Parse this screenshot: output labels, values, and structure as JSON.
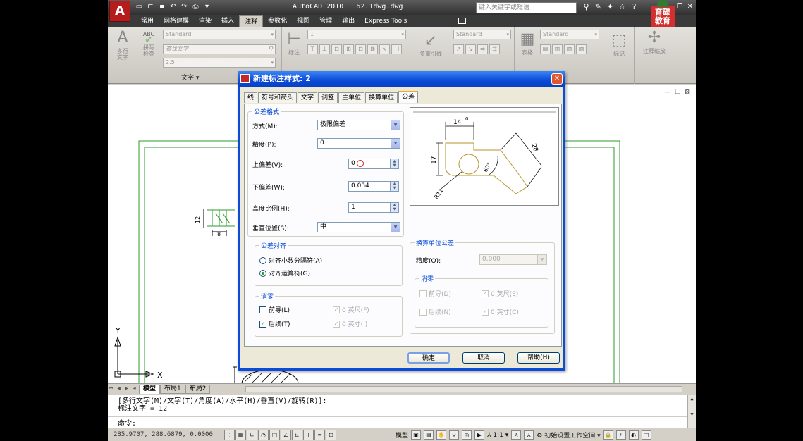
{
  "app": {
    "title": "AutoCAD 2010   62.1dwg.dwg",
    "logo": "A",
    "search_placeholder": "键入关键字或短语",
    "badge_line1": "育碟",
    "badge_line2": "教育"
  },
  "ribbon_tabs": [
    {
      "label": "常用",
      "active": false
    },
    {
      "label": "网格建模",
      "active": false
    },
    {
      "label": "渲染",
      "active": false
    },
    {
      "label": "插入",
      "active": false
    },
    {
      "label": "注释",
      "active": true
    },
    {
      "label": "参数化",
      "active": false
    },
    {
      "label": "视图",
      "active": false
    },
    {
      "label": "管理",
      "active": false
    },
    {
      "label": "输出",
      "active": false
    },
    {
      "label": "Express Tools",
      "active": false
    }
  ],
  "ribbon": {
    "multiline_text_label1": "多行",
    "multiline_text_label2": "文字",
    "spell_check_label1": "拼写",
    "spell_check_label2": "检查",
    "abc": "ABC",
    "text_style": "Standard",
    "find_text": "查找文字",
    "text_height": "2.5",
    "text_group": "文字",
    "dim_label": "标注",
    "dim_style": "1",
    "mleader_label": "多重引线",
    "mleader_style": "Standard",
    "table_label": "表格",
    "table_style": "Standard",
    "markup_label": "标记",
    "scale_label": "注释缩放"
  },
  "dialog": {
    "title": "新建标注样式: 2",
    "tabs": [
      {
        "label": "线",
        "active": false
      },
      {
        "label": "符号和箭头",
        "active": false
      },
      {
        "label": "文字",
        "active": false
      },
      {
        "label": "调整",
        "active": false
      },
      {
        "label": "主单位",
        "active": false
      },
      {
        "label": "换算单位",
        "active": false
      },
      {
        "label": "公差",
        "active": true
      }
    ],
    "tolerance_format": {
      "legend": "公差格式",
      "method_label": "方式(M):",
      "method_value": "极限偏差",
      "precision_label": "精度(P):",
      "precision_value": "0",
      "upper_label": "上偏差(V):",
      "upper_value": "0",
      "lower_label": "下偏差(W):",
      "lower_value": "0.034",
      "height_label": "高度比例(H):",
      "height_value": "1",
      "vpos_label": "垂直位置(S):",
      "vpos_value": "中"
    },
    "alignment": {
      "legend": "公差对齐",
      "opt1": "对齐小数分隔符(A)",
      "opt2": "对齐运算符(G)",
      "selected": 2
    },
    "zero_suppression": {
      "legend": "消零",
      "leading": "前导(L)",
      "leading_checked": false,
      "trailing": "后续(T)",
      "trailing_checked": true,
      "feet": "0 英尺(F)",
      "inches": "0 英寸(I)"
    },
    "alt_units": {
      "legend": "换算单位公差",
      "precision_label": "精度(O):",
      "precision_value": "0.000",
      "zero_legend": "消零",
      "leading": "前导(D)",
      "trailing": "后续(N)",
      "feet": "0 英尺(E)",
      "inches": "0 英寸(C)"
    },
    "preview": {
      "dim1": "14",
      "dim2": "17",
      "dim3": "28",
      "angle": "60°",
      "radius": "R11",
      "tol": "0"
    },
    "buttons": {
      "ok": "确定",
      "cancel": "取消",
      "help": "帮助(H)"
    }
  },
  "drawing": {
    "dim_text": "12",
    "dim_text2": "8",
    "ucs_y": "Y",
    "ucs_x": "X"
  },
  "layout_tabs": [
    {
      "label": "模型",
      "active": true
    },
    {
      "label": "布局1",
      "active": false
    },
    {
      "label": "布局2",
      "active": false
    }
  ],
  "command": {
    "line1": "[多行文字(M)/文字(T)/角度(A)/水平(H)/垂直(V)/旋转(R)]:",
    "line2": "标注文字 = 12",
    "prompt": "命令:"
  },
  "status": {
    "coords": "285.9707, 288.6879, 0.0000",
    "model": "模型",
    "scale": "1:1",
    "workspace": "初始设置工作空间"
  }
}
